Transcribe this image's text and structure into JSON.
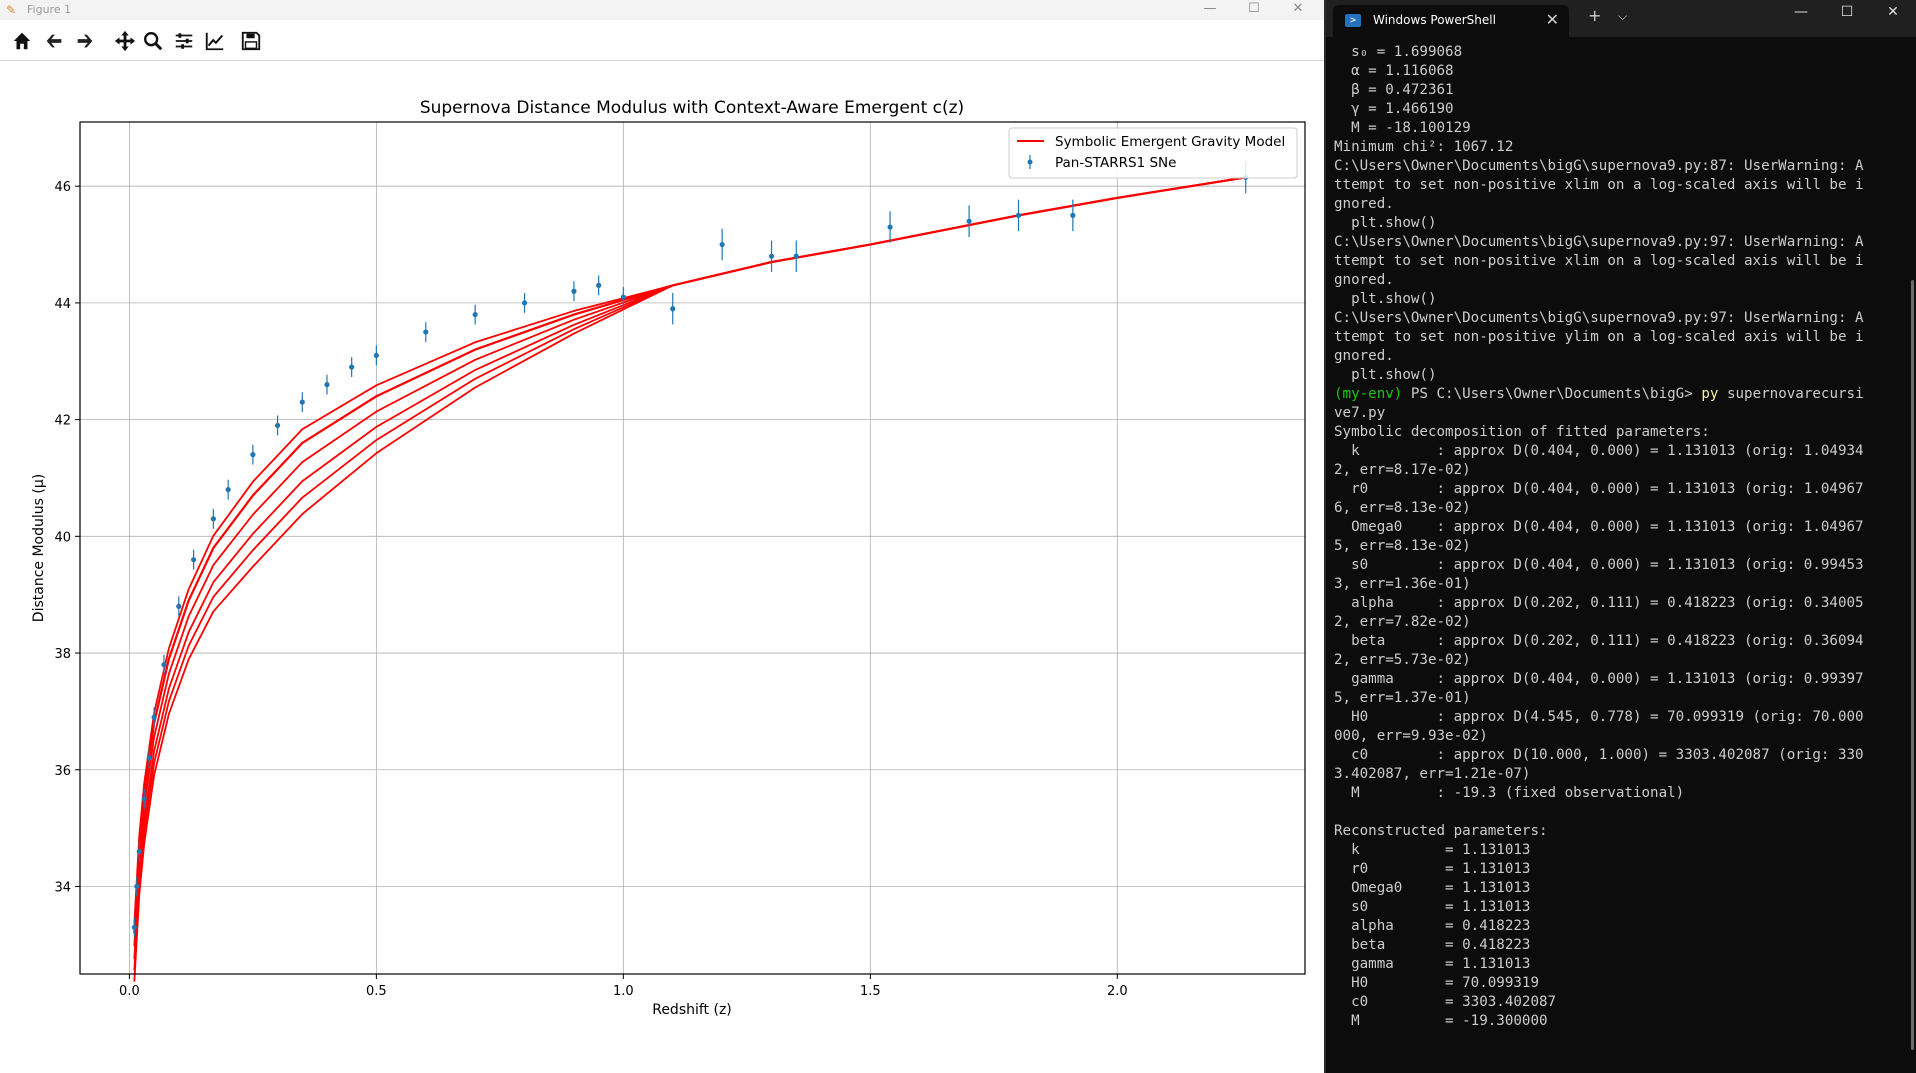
{
  "figure_window": {
    "title": "Figure 1",
    "toolbar": [
      {
        "name": "home-icon"
      },
      {
        "name": "back-icon"
      },
      {
        "name": "forward-icon"
      },
      {
        "name": "pan-icon"
      },
      {
        "name": "zoom-icon"
      },
      {
        "name": "subplots-icon"
      },
      {
        "name": "edit-axis-icon"
      },
      {
        "name": "save-icon"
      }
    ]
  },
  "chart_data": {
    "type": "scatter",
    "title": "Supernova Distance Modulus with Context-Aware Emergent c(z)",
    "xlabel": "Redshift (z)",
    "ylabel": "Distance Modulus (μ)",
    "xlim": [
      -0.1,
      2.38
    ],
    "ylim": [
      32.5,
      47.1
    ],
    "xticks": [
      "0.0",
      "0.5",
      "1.0",
      "1.5",
      "2.0"
    ],
    "yticks": [
      "34",
      "36",
      "38",
      "40",
      "42",
      "44",
      "46"
    ],
    "grid": true,
    "legend_position": "top-right",
    "colors": {
      "model": "#ff0000",
      "data": "#1f77b4"
    },
    "series": [
      {
        "name": "Symbolic Emergent Gravity Model",
        "type": "line",
        "x": [
          0.01,
          0.02,
          0.03,
          0.05,
          0.08,
          0.12,
          0.17,
          0.25,
          0.35,
          0.5,
          0.7,
          0.9,
          1.1,
          1.3,
          1.5,
          1.8,
          2.0,
          2.26
        ],
        "y": [
          33.2,
          34.7,
          35.6,
          36.8,
          37.9,
          38.9,
          39.8,
          40.7,
          41.6,
          42.4,
          43.2,
          43.8,
          44.3,
          44.7,
          45.0,
          45.5,
          45.8,
          46.15
        ]
      },
      {
        "name": "Pan-STARRS1 SNe",
        "type": "errorbar",
        "x": [
          0.01,
          0.015,
          0.02,
          0.03,
          0.04,
          0.05,
          0.07,
          0.1,
          0.13,
          0.17,
          0.2,
          0.25,
          0.3,
          0.35,
          0.4,
          0.45,
          0.5,
          0.6,
          0.7,
          0.8,
          0.9,
          0.95,
          1.0,
          1.1,
          1.2,
          1.3,
          1.35,
          1.54,
          1.7,
          1.8,
          1.91,
          2.26
        ],
        "y": [
          33.3,
          34.0,
          34.6,
          35.5,
          36.2,
          36.9,
          37.8,
          38.8,
          39.6,
          40.3,
          40.8,
          41.4,
          41.9,
          42.3,
          42.6,
          42.9,
          43.1,
          43.5,
          43.8,
          44.0,
          44.2,
          44.3,
          44.1,
          43.9,
          45.0,
          44.8,
          44.8,
          45.3,
          45.4,
          45.5,
          45.5,
          46.15
        ]
      }
    ]
  },
  "terminal": {
    "tab_title": "Windows PowerShell",
    "line1": "  s₀ = 1.699068",
    "line2": "  α = 1.116068",
    "line3": "  β = 0.472361",
    "line4": "  γ = 1.466190",
    "line5": "  M = -18.100129",
    "line6": "Minimum chi²: 1067.12",
    "line7": "C:\\Users\\Owner\\Documents\\bigG\\supernova9.py:87: UserWarning: A",
    "line8": "ttempt to set non-positive xlim on a log-scaled axis will be i",
    "line9": "gnored.",
    "line10": "  plt.show()",
    "line11": "C:\\Users\\Owner\\Documents\\bigG\\supernova9.py:97: UserWarning: A",
    "line12": "ttempt to set non-positive xlim on a log-scaled axis will be i",
    "line13": "gnored.",
    "line14": "  plt.show()",
    "line15": "C:\\Users\\Owner\\Documents\\bigG\\supernova9.py:97: UserWarning: A",
    "line16": "ttempt to set non-positive ylim on a log-scaled axis will be i",
    "line17": "gnored.",
    "line18": "  plt.show()",
    "prompt_env": "(my-env)",
    "prompt_path": " PS C:\\Users\\Owner\\Documents\\bigG> ",
    "prompt_cmd": "py",
    "prompt_args": " supernovarecursi",
    "line20": "ve7.py",
    "line21": "Symbolic decomposition of fitted parameters:",
    "line22": "  k         : approx D(0.404, 0.000) = 1.131013 (orig: 1.04934",
    "line23": "2, err=8.17e-02)",
    "line24": "  r0        : approx D(0.404, 0.000) = 1.131013 (orig: 1.04967",
    "line25": "6, err=8.13e-02)",
    "line26": "  Omega0    : approx D(0.404, 0.000) = 1.131013 (orig: 1.04967",
    "line27": "5, err=8.13e-02)",
    "line28": "  s0        : approx D(0.404, 0.000) = 1.131013 (orig: 0.99453",
    "line29": "3, err=1.36e-01)",
    "line30": "  alpha     : approx D(0.202, 0.111) = 0.418223 (orig: 0.34005",
    "line31": "2, err=7.82e-02)",
    "line32": "  beta      : approx D(0.202, 0.111) = 0.418223 (orig: 0.36094",
    "line33": "2, err=5.73e-02)",
    "line34": "  gamma     : approx D(0.404, 0.000) = 1.131013 (orig: 0.99397",
    "line35": "5, err=1.37e-01)",
    "line36": "  H0        : approx D(4.545, 0.778) = 70.099319 (orig: 70.000",
    "line37": "000, err=9.93e-02)",
    "line38": "  c0        : approx D(10.000, 1.000) = 3303.402087 (orig: 330",
    "line39": "3.402087, err=1.21e-07)",
    "line40": "  M         : -19.3 (fixed observational)",
    "line41": "",
    "line42": "Reconstructed parameters:",
    "line43": "  k          = 1.131013",
    "line44": "  r0         = 1.131013",
    "line45": "  Omega0     = 1.131013",
    "line46": "  s0         = 1.131013",
    "line47": "  alpha      = 0.418223",
    "line48": "  beta       = 0.418223",
    "line49": "  gamma      = 1.131013",
    "line50": "  H0         = 70.099319",
    "line51": "  c0         = 3303.402087",
    "line52": "  M          = -19.300000"
  }
}
